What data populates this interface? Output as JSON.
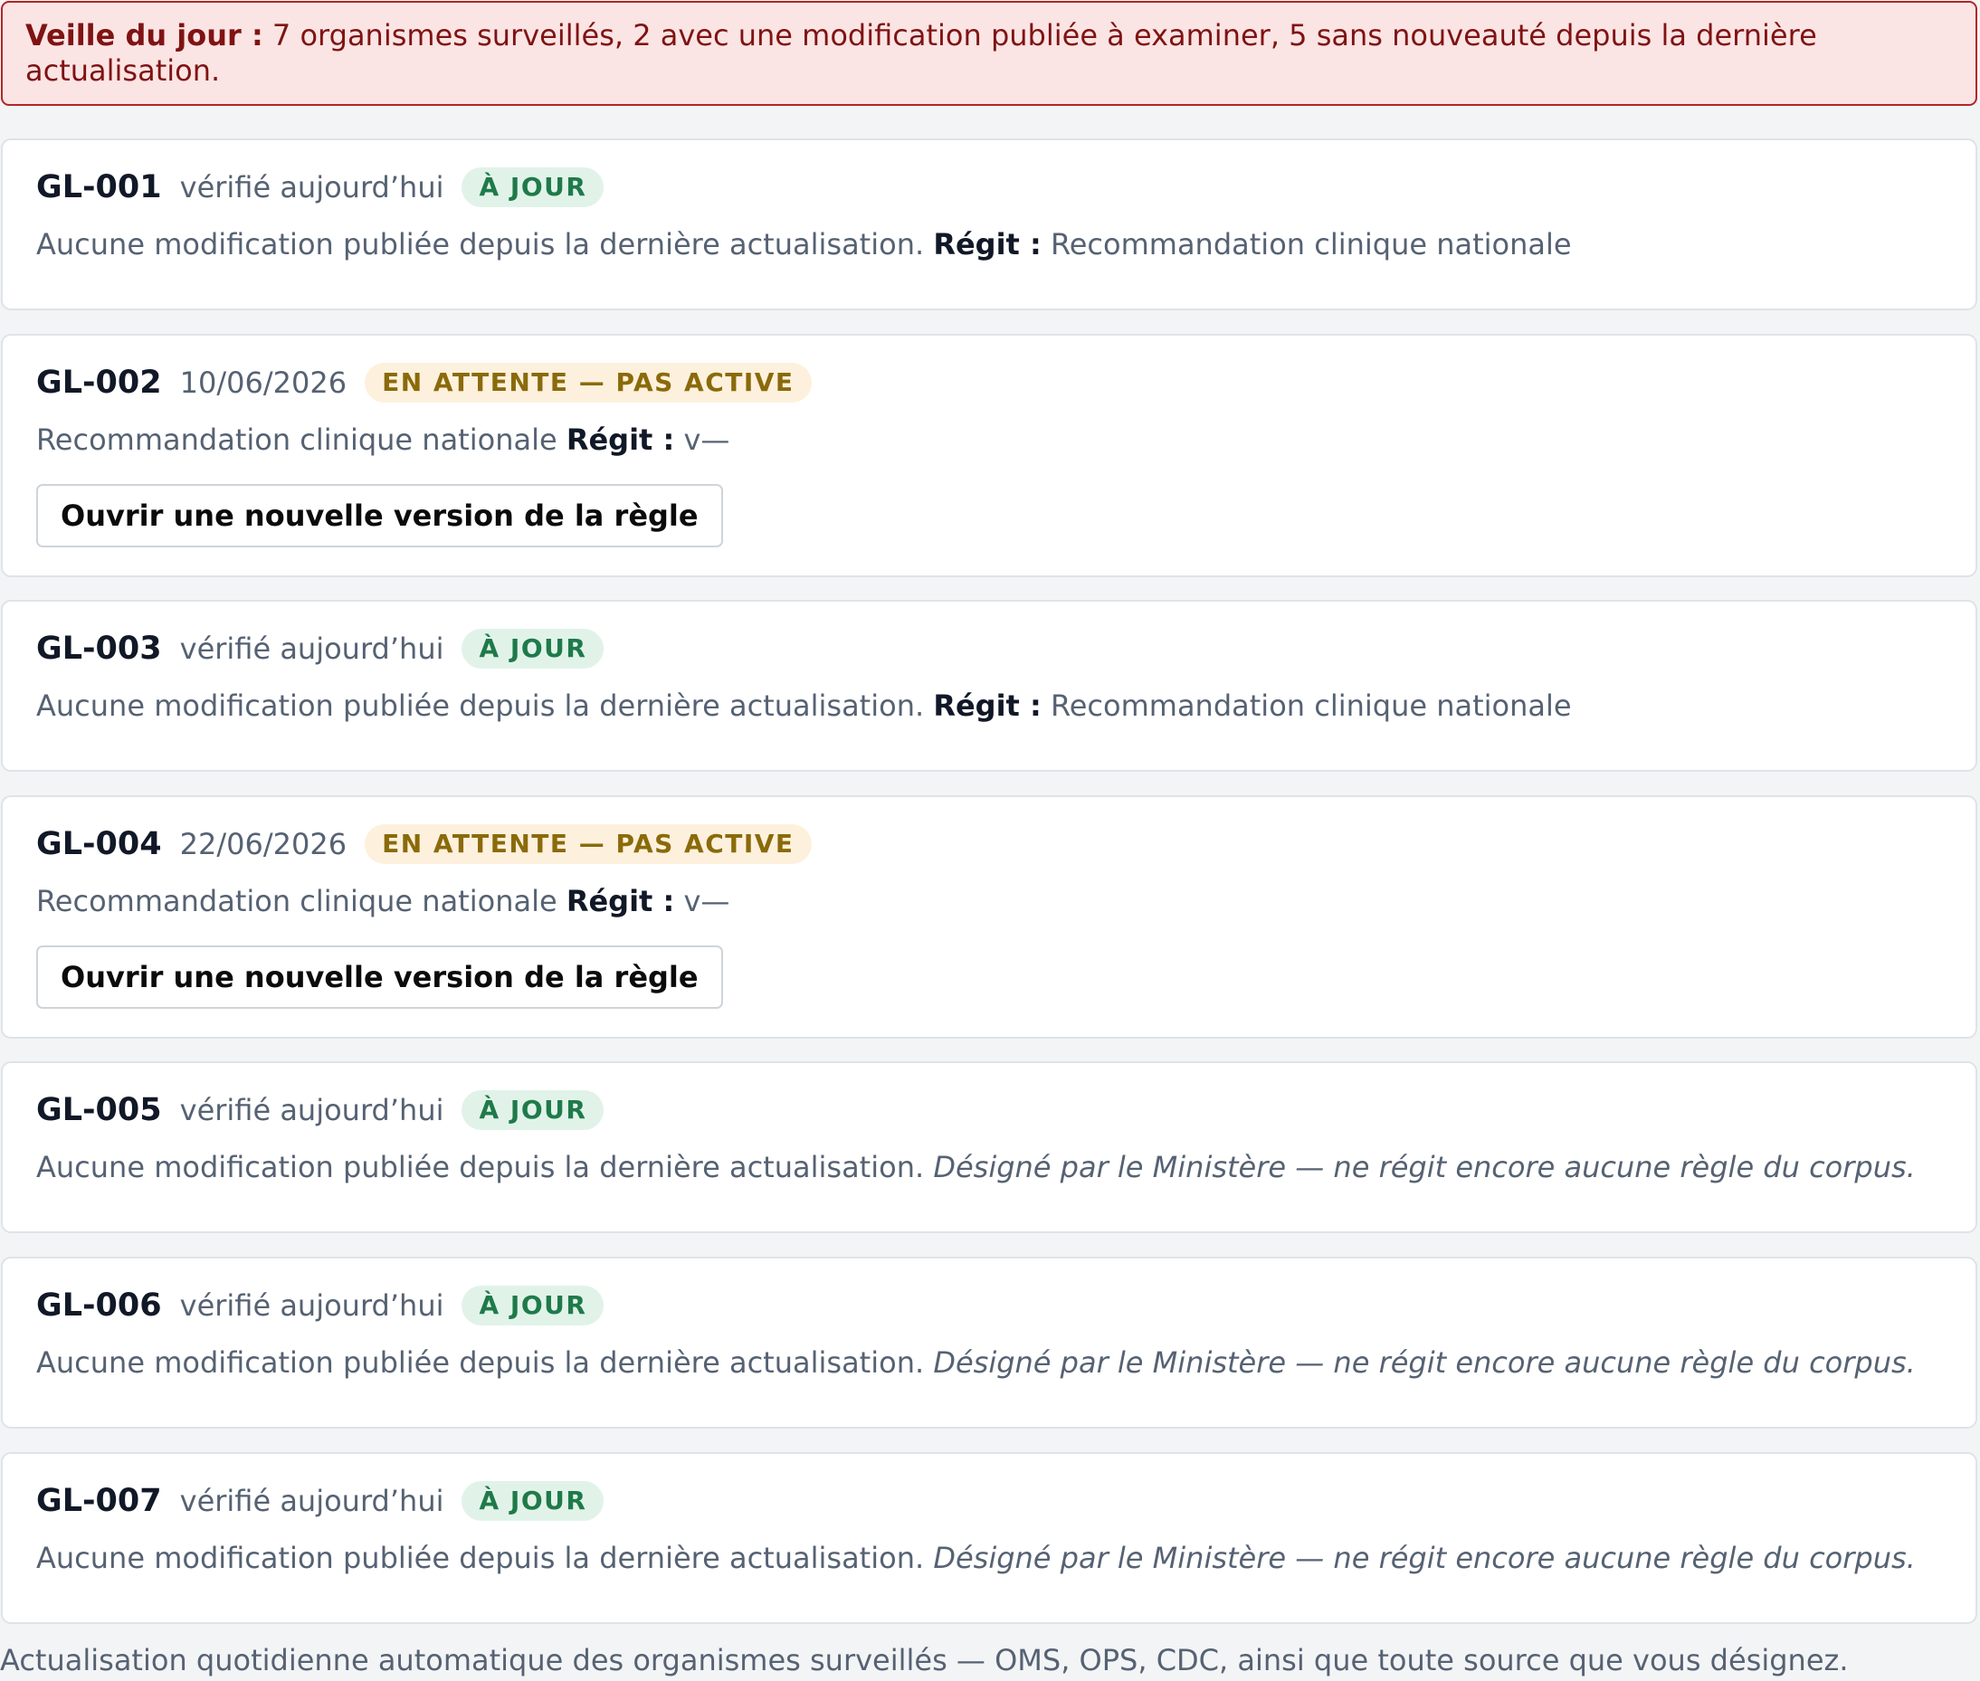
{
  "summary": {
    "label": "Veille du jour :",
    "text": "7 organismes surveillés, 2 avec une modification publiée à examiner, 5 sans nouveauté depuis la dernière actualisation."
  },
  "cards": [
    {
      "id": "GL-001",
      "date": "vérifié aujourd’hui",
      "status": "À JOUR",
      "status_kind": "ok",
      "text": "Aucune modification publiée depuis la dernière actualisation.",
      "regit_label": "Régit :",
      "regit_value": "Recommandation clinique nationale"
    },
    {
      "id": "GL-002",
      "date": "10/06/2026",
      "status": "EN ATTENTE — PAS ACTIVE",
      "status_kind": "pending",
      "text": "Recommandation clinique nationale",
      "regit_label": "Régit :",
      "regit_value": "v—",
      "button": "Ouvrir une nouvelle version de la règle"
    },
    {
      "id": "GL-003",
      "date": "vérifié aujourd’hui",
      "status": "À JOUR",
      "status_kind": "ok",
      "text": "Aucune modification publiée depuis la dernière actualisation.",
      "regit_label": "Régit :",
      "regit_value": "Recommandation clinique nationale"
    },
    {
      "id": "GL-004",
      "date": "22/06/2026",
      "status": "EN ATTENTE — PAS ACTIVE",
      "status_kind": "pending",
      "text": "Recommandation clinique nationale",
      "regit_label": "Régit :",
      "regit_value": "v—",
      "button": "Ouvrir une nouvelle version de la règle"
    },
    {
      "id": "GL-005",
      "date": "vérifié aujourd’hui",
      "status": "À JOUR",
      "status_kind": "ok",
      "text": "Aucune modification publiée depuis la dernière actualisation.",
      "note": "Désigné par le Ministère — ne régit encore aucune règle du corpus."
    },
    {
      "id": "GL-006",
      "date": "vérifié aujourd’hui",
      "status": "À JOUR",
      "status_kind": "ok",
      "text": "Aucune modification publiée depuis la dernière actualisation.",
      "note": "Désigné par le Ministère — ne régit encore aucune règle du corpus."
    },
    {
      "id": "GL-007",
      "date": "vérifié aujourd’hui",
      "status": "À JOUR",
      "status_kind": "ok",
      "text": "Aucune modification publiée depuis la dernière actualisation.",
      "note": "Désigné par le Ministère — ne régit encore aucune règle du corpus."
    }
  ],
  "footer": "Actualisation quotidienne automatique des organismes surveillés — OMS, OPS, CDC, ainsi que toute source que vous désignez.",
  "colors": {
    "alert_bg": "#fbe4e4",
    "alert_border": "#b42525",
    "ok_badge_bg": "#e1f3e9",
    "ok_badge_text": "#1f7a4a",
    "pending_badge_bg": "#fdf1dd",
    "pending_badge_text": "#8a6a0a"
  }
}
